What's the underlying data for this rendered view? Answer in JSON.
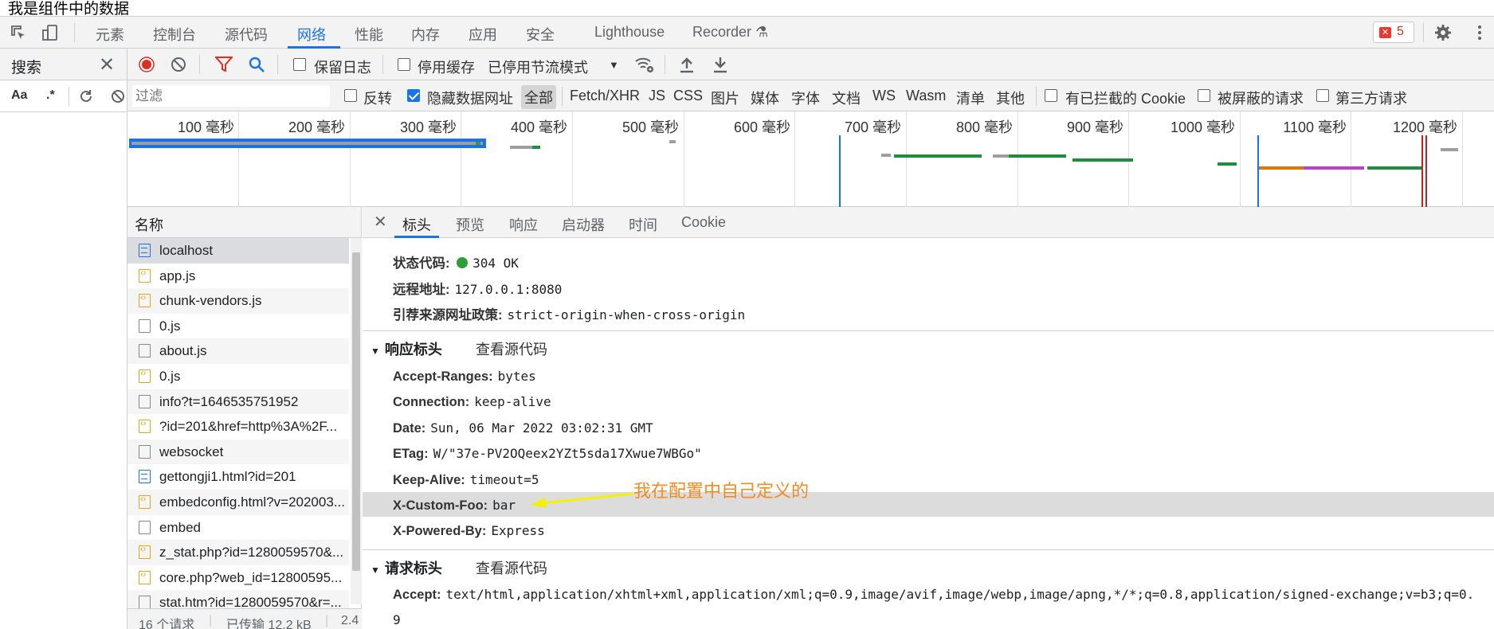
{
  "page_text": "我是组件中的数据",
  "devtools": {
    "tabs": [
      {
        "label": "元素"
      },
      {
        "label": "控制台"
      },
      {
        "label": "源代码"
      },
      {
        "label": "网络",
        "active": true
      },
      {
        "label": "性能"
      },
      {
        "label": "内存"
      },
      {
        "label": "应用"
      },
      {
        "label": "安全"
      },
      {
        "label": "Lighthouse"
      },
      {
        "label": "Recorder"
      }
    ],
    "error_count": "5"
  },
  "search_panel": {
    "title": "搜索",
    "tools": [
      "Aa",
      ".*"
    ]
  },
  "toolbar": {
    "preserve_log": "保留日志",
    "disable_cache": "停用缓存",
    "throttling": "已停用节流模式"
  },
  "filterbar": {
    "placeholder": "过滤",
    "invert": "反转",
    "hide_data_urls": "隐藏数据网址",
    "types": [
      "全部",
      "Fetch/XHR",
      "JS",
      "CSS",
      "图片",
      "媒体",
      "字体",
      "文档",
      "WS",
      "Wasm",
      "清单",
      "其他"
    ],
    "blocked_cookies": "有已拦截的 Cookie",
    "blocked_requests": "被屏蔽的请求",
    "third_party": "第三方请求"
  },
  "overview": {
    "ticks": [
      "100 毫秒",
      "200 毫秒",
      "300 毫秒",
      "400 毫秒",
      "500 毫秒",
      "600 毫秒",
      "700 毫秒",
      "800 毫秒",
      "900 毫秒",
      "1000 毫秒",
      "1100 毫秒",
      "1200 毫秒"
    ]
  },
  "requests": {
    "header": "名称",
    "items": [
      {
        "name": "localhost",
        "type": "doc"
      },
      {
        "name": "app.js",
        "type": "js"
      },
      {
        "name": "chunk-vendors.js",
        "type": "js"
      },
      {
        "name": "0.js",
        "type": "other"
      },
      {
        "name": "about.js",
        "type": "other"
      },
      {
        "name": "0.js",
        "type": "js"
      },
      {
        "name": "info?t=1646535751952",
        "type": "other"
      },
      {
        "name": "?id=201&href=http%3A%2F...",
        "type": "js"
      },
      {
        "name": "websocket",
        "type": "other"
      },
      {
        "name": "gettongji1.html?id=201",
        "type": "doc"
      },
      {
        "name": "embedconfig.html?v=202003...",
        "type": "js"
      },
      {
        "name": "embed",
        "type": "other"
      },
      {
        "name": "z_stat.php?id=1280059570&...",
        "type": "js"
      },
      {
        "name": "core.php?web_id=12800595...",
        "type": "js"
      },
      {
        "name": "stat.htm?id=1280059570&r=...",
        "type": "other"
      }
    ],
    "status": [
      "16 个请求",
      "已传输 12.2 kB",
      "2.4"
    ]
  },
  "details": {
    "tabs": [
      "标头",
      "预览",
      "响应",
      "启动器",
      "时间",
      "Cookie"
    ],
    "general": [
      {
        "key": "状态代码:",
        "value": "304 OK"
      },
      {
        "key": "远程地址:",
        "value": "127.0.0.1:8080"
      },
      {
        "key": "引荐来源网址政策:",
        "value": "strict-origin-when-cross-origin"
      }
    ],
    "response_headers_title": "响应标头",
    "view_source": "查看源代码",
    "response_headers": [
      {
        "key": "Accept-Ranges:",
        "value": "bytes"
      },
      {
        "key": "Connection:",
        "value": "keep-alive"
      },
      {
        "key": "Date:",
        "value": "Sun, 06 Mar 2022 03:02:31 GMT"
      },
      {
        "key": "ETag:",
        "value": "W/\"37e-PV2OQeex2YZt5sda17Xwue7WBGo\""
      },
      {
        "key": "Keep-Alive:",
        "value": "timeout=5"
      },
      {
        "key": "X-Custom-Foo:",
        "value": "bar"
      },
      {
        "key": "X-Powered-By:",
        "value": "Express"
      }
    ],
    "request_headers_title": "请求标头",
    "request_headers": [
      {
        "key": "Accept:",
        "value": "text/html,application/xhtml+xml,application/xml;q=0.9,image/avif,image/webp,image/apng,*/*;q=0.8,application/signed-exchange;v=b3;q=0."
      },
      {
        "key": "",
        "value": "9"
      }
    ]
  },
  "annotation": "我在配置中自己定义的",
  "colors": {
    "accent": "#1a73e8",
    "annotation": "#f28b20",
    "status_ok": "#2e9e3a"
  }
}
